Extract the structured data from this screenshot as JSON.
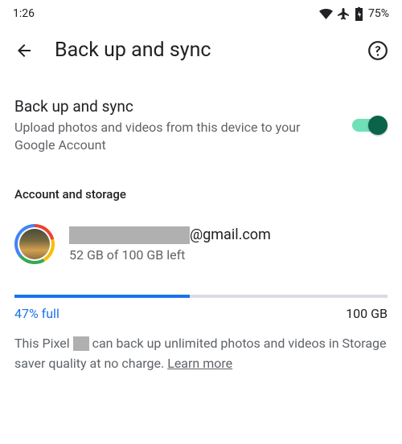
{
  "status": {
    "time": "1:26",
    "battery": "75%"
  },
  "header": {
    "title": "Back up and sync"
  },
  "setting": {
    "title": "Back up and sync",
    "desc": "Upload photos and videos from this device to your Google Account",
    "enabled": true
  },
  "section": {
    "label": "Account and storage"
  },
  "account": {
    "email_suffix": "@gmail.com",
    "storage_left": "52 GB of 100 GB left"
  },
  "storage": {
    "percent_label": "47% full",
    "percent_value": 47,
    "total_label": "100 GB"
  },
  "footer": {
    "prefix": "This Pixel ",
    "suffix": " can back up unlimited photos and videos in Storage saver quality at no charge. ",
    "learn_more": "Learn more"
  }
}
